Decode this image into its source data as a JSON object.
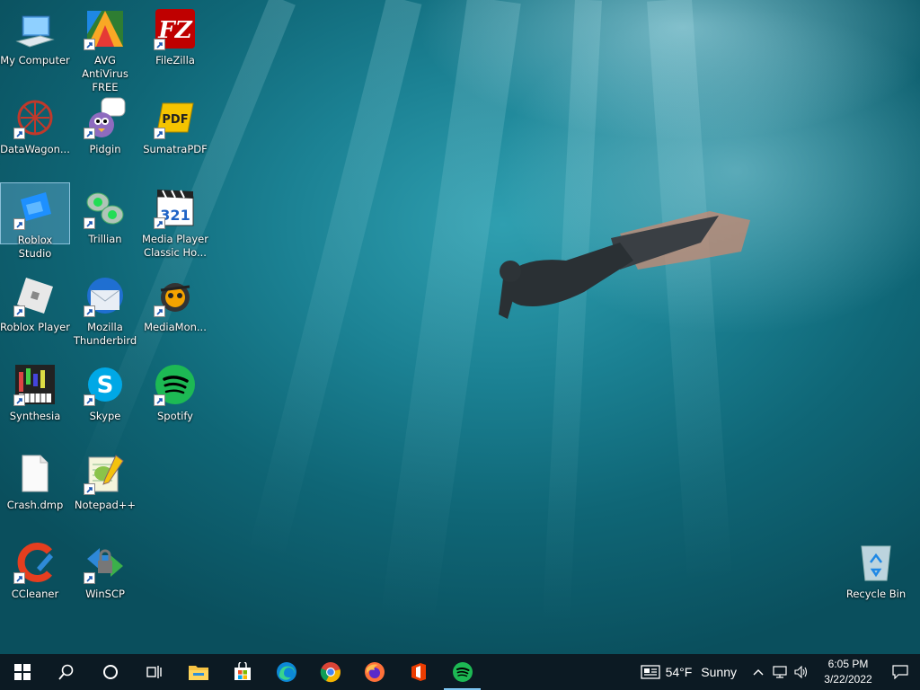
{
  "desktop": {
    "icons": [
      {
        "label": "My Computer",
        "icon": "computer-icon"
      },
      {
        "label": "AVG AntiVirus FREE",
        "icon": "avg-antivirus-icon"
      },
      {
        "label": "FileZilla",
        "icon": "filezilla-icon"
      },
      {
        "label": "DataWagon...",
        "icon": "datawagon-icon"
      },
      {
        "label": "Pidgin",
        "icon": "pidgin-icon"
      },
      {
        "label": "SumatraPDF",
        "icon": "sumatrapdf-icon"
      },
      {
        "label": "Roblox Studio",
        "icon": "roblox-studio-icon"
      },
      {
        "label": "Trillian",
        "icon": "trillian-icon"
      },
      {
        "label": "Media Player Classic Ho...",
        "icon": "media-player-classic-icon"
      },
      {
        "label": "Roblox Player",
        "icon": "roblox-player-icon"
      },
      {
        "label": "Mozilla Thunderbird",
        "icon": "thunderbird-icon"
      },
      {
        "label": "MediaMon...",
        "icon": "mediamonkey-icon"
      },
      {
        "label": "Synthesia",
        "icon": "synthesia-icon"
      },
      {
        "label": "Skype",
        "icon": "skype-icon"
      },
      {
        "label": "Spotify",
        "icon": "spotify-icon"
      },
      {
        "label": "Crash.dmp",
        "icon": "file-icon"
      },
      {
        "label": "Notepad++",
        "icon": "notepadpp-icon"
      },
      {
        "label": "CCleaner",
        "icon": "ccleaner-icon"
      },
      {
        "label": "WinSCP",
        "icon": "winscp-icon"
      },
      {
        "label": "Recycle Bin",
        "icon": "recycle-bin-icon"
      }
    ]
  },
  "taskbar": {
    "apps": [
      "start-icon",
      "search-icon",
      "cortana-icon",
      "task-view-icon",
      "file-explorer-icon",
      "microsoft-store-icon",
      "edge-icon",
      "chrome-icon",
      "firefox-icon",
      "office-icon",
      "spotify-icon"
    ],
    "weather": {
      "temp": "54°F",
      "condition": "Sunny"
    },
    "clock": {
      "time": "6:05 PM",
      "date": "3/22/2022"
    }
  },
  "colors": {
    "taskbar": "#0c1a23",
    "active_indicator": "#7cc4f0",
    "selection": "#78bee6"
  }
}
